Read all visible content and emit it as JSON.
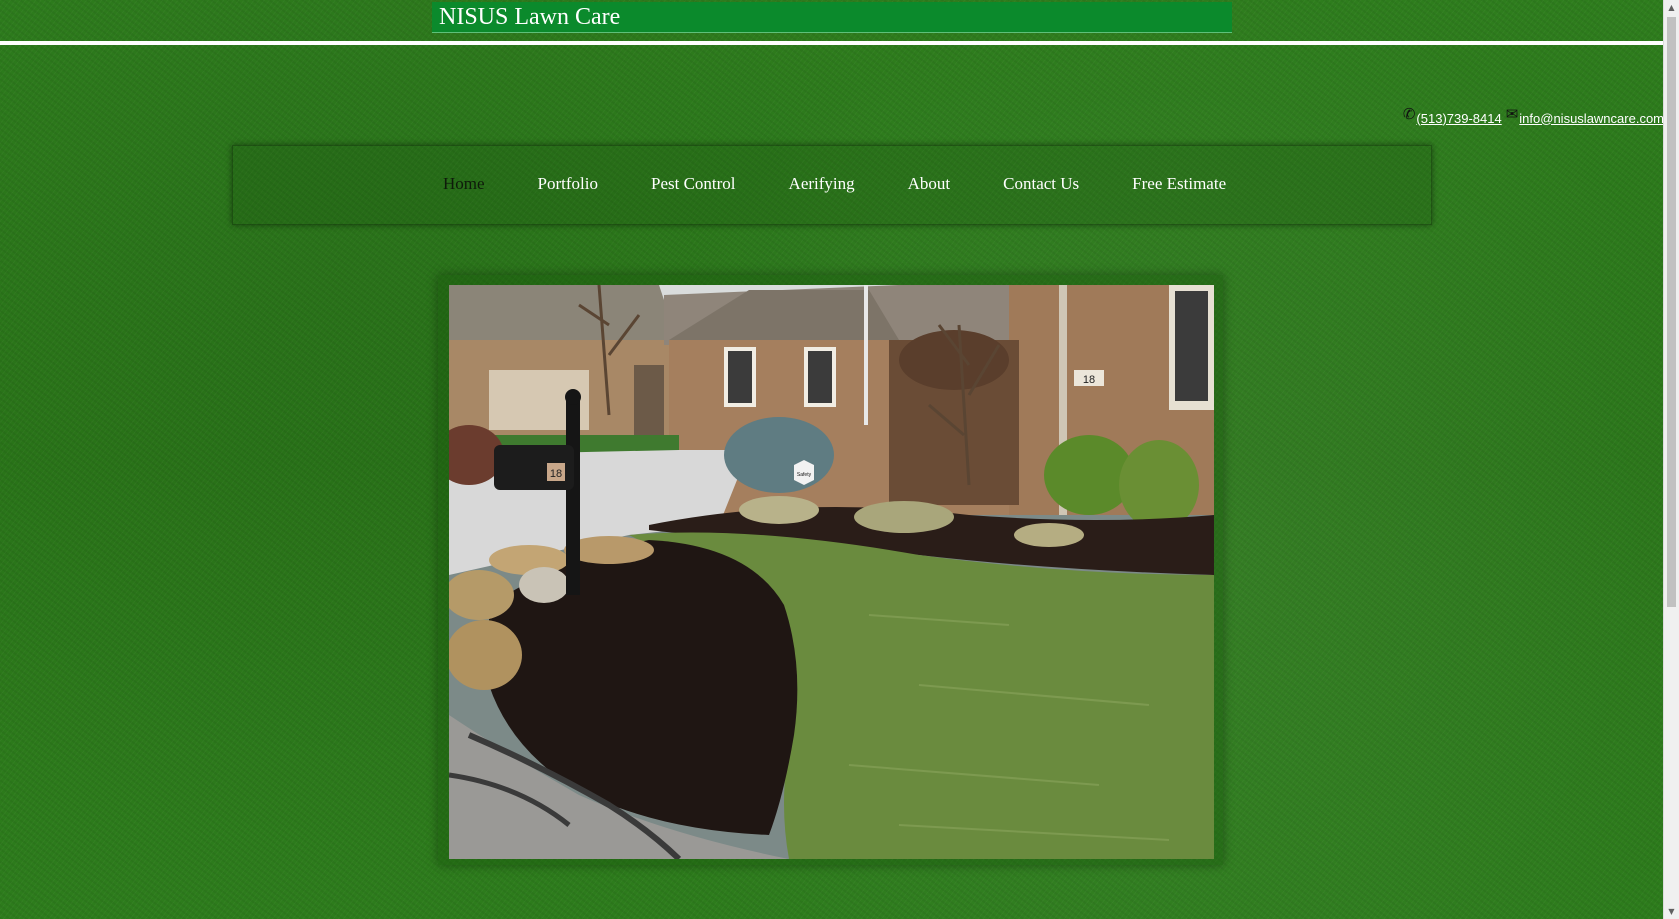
{
  "header": {
    "site_title": "NISUS Lawn Care"
  },
  "contact": {
    "phone_icon": "phone-icon",
    "phone": "(513)739-8414",
    "email_icon": "envelope-icon",
    "email": "info@nisuslawncare.com"
  },
  "nav": {
    "items": [
      {
        "label": "Home",
        "active": true
      },
      {
        "label": "Portfolio",
        "active": false
      },
      {
        "label": "Pest Control",
        "active": false
      },
      {
        "label": "Aerifying",
        "active": false
      },
      {
        "label": "About",
        "active": false
      },
      {
        "label": "Contact Us",
        "active": false
      },
      {
        "label": "Free Estimate",
        "active": false
      }
    ]
  },
  "photo": {
    "house_number": "18",
    "mailbox_number": "18",
    "sign_text": "Safety"
  },
  "colors": {
    "title_bar": "#0b8a2c",
    "background_grass": "#2f7f1c",
    "nav_active": "#0e1a0a",
    "nav_text": "#ffffff"
  }
}
